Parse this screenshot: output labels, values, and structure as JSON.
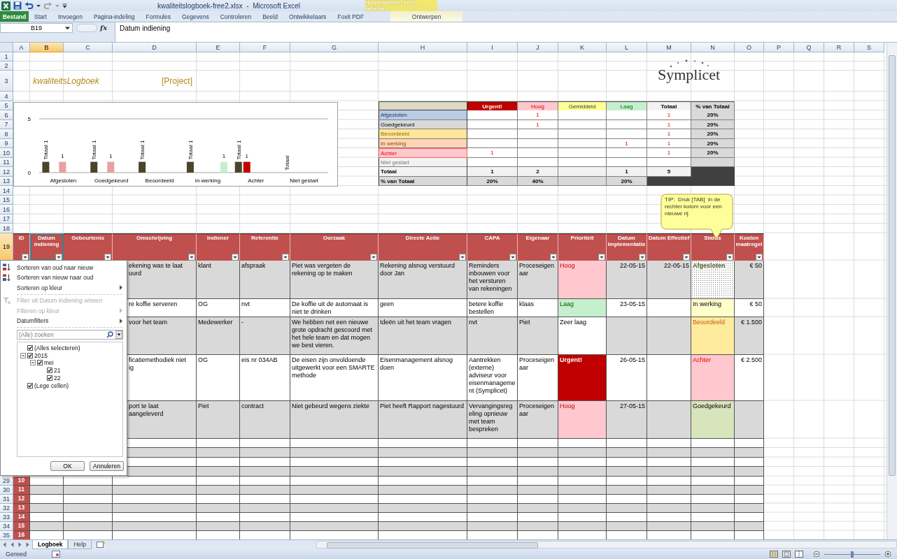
{
  "window": {
    "title": "kwaliteitslogboek-free2.xlsx  -  Microsoft Excel",
    "context_group": "Hulpmiddelen voor tabellen"
  },
  "ribbon_tabs": [
    {
      "label": "Bestand",
      "kind": "file"
    },
    {
      "label": "Start",
      "kind": "normal"
    },
    {
      "label": "Invoegen",
      "kind": "normal"
    },
    {
      "label": "Pagina-indeling",
      "kind": "normal"
    },
    {
      "label": "Formules",
      "kind": "normal"
    },
    {
      "label": "Gegevens",
      "kind": "normal"
    },
    {
      "label": "Controleren",
      "kind": "normal"
    },
    {
      "label": "Beeld",
      "kind": "normal"
    },
    {
      "label": "Ontwikkelaars",
      "kind": "normal"
    },
    {
      "label": "Foxit PDF",
      "kind": "normal"
    },
    {
      "label": "Ontwerpen",
      "kind": "contextual"
    }
  ],
  "formula_bar": {
    "name_box": "B19",
    "function_label": "fx",
    "content": "Datum indiening"
  },
  "sheet": {
    "columns": [
      {
        "letter": "A",
        "selected": false
      },
      {
        "letter": "B",
        "selected": true
      },
      {
        "letter": "C",
        "selected": false
      },
      {
        "letter": "D",
        "selected": false
      },
      {
        "letter": "E",
        "selected": false
      },
      {
        "letter": "F",
        "selected": false
      },
      {
        "letter": "G",
        "selected": false
      },
      {
        "letter": "H",
        "selected": false
      },
      {
        "letter": "I",
        "selected": false
      },
      {
        "letter": "J",
        "selected": false
      },
      {
        "letter": "K",
        "selected": false
      },
      {
        "letter": "L",
        "selected": false
      },
      {
        "letter": "M",
        "selected": false
      },
      {
        "letter": "N",
        "selected": false
      },
      {
        "letter": "O",
        "selected": false
      },
      {
        "letter": "P",
        "selected": false
      },
      {
        "letter": "Q",
        "selected": false
      },
      {
        "letter": "R",
        "selected": false
      },
      {
        "letter": "S",
        "selected": false
      }
    ],
    "row_headers_top": [
      {
        "label": "1",
        "selected": false
      },
      {
        "label": "2",
        "selected": false
      },
      {
        "label": "3",
        "selected": false
      },
      {
        "label": "4",
        "selected": false
      },
      {
        "label": "5",
        "selected": false
      },
      {
        "label": "6",
        "selected": false
      },
      {
        "label": "7",
        "selected": false
      },
      {
        "label": "8",
        "selected": false
      },
      {
        "label": "9",
        "selected": false
      },
      {
        "label": "10",
        "selected": false
      },
      {
        "label": "11",
        "selected": false
      },
      {
        "label": "12",
        "selected": false
      },
      {
        "label": "13",
        "selected": false
      },
      {
        "label": "14",
        "selected": false
      },
      {
        "label": "15",
        "selected": false
      },
      {
        "label": "16",
        "selected": false
      },
      {
        "label": "17",
        "selected": false
      },
      {
        "label": "18",
        "selected": false
      },
      {
        "label": "19",
        "selected": true
      }
    ],
    "row_headers_bottom": [
      {
        "label": "29",
        "selected": false
      },
      {
        "label": "30",
        "selected": false
      },
      {
        "label": "31",
        "selected": false
      },
      {
        "label": "32",
        "selected": false
      },
      {
        "label": "33",
        "selected": false
      },
      {
        "label": "34",
        "selected": false
      },
      {
        "label": "35",
        "selected": false
      }
    ]
  },
  "title": "kwaliteitsLogboek",
  "project": "[Project]",
  "logo": "Symplicet",
  "chart": {
    "chart_data": {
      "type": "bar",
      "categories": [
        "Afgesloten",
        "Goedgekeurd",
        "Beoordeeld",
        "In werking",
        "Achter",
        "Niet gestart"
      ],
      "series": [
        {
          "color": "#4a452a",
          "values": [
            1,
            1,
            1,
            1,
            1,
            null
          ]
        },
        {
          "color": "#c00000",
          "values": [
            null,
            null,
            null,
            null,
            1,
            null
          ]
        },
        {
          "color": "#e6a1a1",
          "values": [
            1,
            1,
            null,
            null,
            null,
            null
          ]
        },
        {
          "color": "#c6efce",
          "values": [
            null,
            null,
            null,
            1,
            null,
            null
          ]
        }
      ],
      "ylim": [
        0,
        5
      ],
      "yticks": [
        0,
        5
      ],
      "value_labels": [
        [
          "Totaal 1",
          "Totaal 1",
          "Totaal 1",
          "Totaal 1",
          "Totaal 1",
          "Totaal"
        ],
        [
          null,
          null,
          null,
          null,
          "1",
          null
        ],
        [
          "1",
          "1",
          null,
          null,
          null,
          null
        ],
        [
          null,
          null,
          null,
          "1",
          null,
          null
        ]
      ]
    }
  },
  "pivot": {
    "columns": [
      {
        "label": "Urgent!",
        "kind": "urgent"
      },
      {
        "label": "Hoog",
        "kind": "high"
      },
      {
        "label": "Gemiddeld",
        "kind": "medium"
      },
      {
        "label": "Laag",
        "kind": "low"
      },
      {
        "label": "Totaal",
        "kind": "total"
      },
      {
        "label": "% van Totaal",
        "kind": "percent"
      }
    ],
    "rows": [
      {
        "label": "Afgesloten",
        "kind": "closed",
        "cells": [
          null,
          "1",
          null,
          null,
          "1",
          "20%"
        ]
      },
      {
        "label": "Goedgekeurd",
        "kind": "approved",
        "cells": [
          null,
          "1",
          null,
          null,
          "1",
          "20%"
        ]
      },
      {
        "label": "Beoordeeld",
        "kind": "reviewed",
        "cells": [
          null,
          null,
          null,
          null,
          "1",
          "20%"
        ]
      },
      {
        "label": "In werking",
        "kind": "in_progress",
        "cells": [
          null,
          null,
          null,
          "1",
          "1",
          "20%"
        ]
      },
      {
        "label": "Achter",
        "kind": "behind",
        "cells": [
          "1",
          null,
          null,
          null,
          "1",
          "20%"
        ]
      },
      {
        "label": "Niet gestart",
        "kind": "not_started",
        "cells": [
          null,
          null,
          null,
          null,
          null,
          null
        ]
      },
      {
        "label": "Totaal",
        "kind": "total",
        "cells": [
          "1",
          "2",
          null,
          "1",
          "5"
        ]
      },
      {
        "label": "% van Totaal",
        "kind": "percent",
        "cells": [
          "20%",
          "40%",
          null,
          "20%"
        ]
      }
    ]
  },
  "comment": {
    "text": "TIP:  Druk [TAB]  in de rechter kolom voor een nieuwe rij"
  },
  "table": {
    "columns": [
      {
        "label": "ID",
        "selected": false
      },
      {
        "label": "Datum indiening",
        "selected": true
      },
      {
        "label": "Gebeurtenis",
        "selected": false
      },
      {
        "label": "Omschrijving",
        "selected": false
      },
      {
        "label": "Indiener",
        "selected": false
      },
      {
        "label": "Referentie",
        "selected": false
      },
      {
        "label": "Oorzaak",
        "selected": false
      },
      {
        "label": "Directe Actie",
        "selected": false
      },
      {
        "label": "CAPA",
        "selected": false
      },
      {
        "label": "Eigenaar",
        "selected": false
      },
      {
        "label": "Prioriteit",
        "selected": false
      },
      {
        "label": "Datum Implementatie",
        "selected": false
      },
      {
        "label": "Datum Effectief",
        "selected": false
      },
      {
        "label": "Status",
        "selected": false
      },
      {
        "label": "Kosten maatregel",
        "selected": false
      }
    ],
    "rows": [
      {
        "omschrijving": "ekening was te laat\nuurd",
        "indiener": "klant",
        "referentie": "afspraak",
        "oorzaak": "Piet was vergeten de rekening op te maken",
        "directe_actie": "Rekening alsnog verstuurd door Jan",
        "capa": "Reminders inbouwen voor het versturen van rekeningen",
        "eigenaar": "Proceseigenaar",
        "prioriteit": {
          "text": "Hoog",
          "kind": "high"
        },
        "datum_implementatie": "22-05-15",
        "datum_effectief": "22-05-15",
        "status": {
          "text": "Afgesloten",
          "kind": "closed"
        },
        "kosten": "€ 50"
      },
      {
        "omschrijving": "re koffie serveren",
        "indiener": "OG",
        "referentie": "nvt",
        "oorzaak": "De koffie uit de automaat is niet te drinken",
        "directe_actie": "geen",
        "capa": "betere koffie bestellen",
        "eigenaar": "klaas",
        "prioriteit": {
          "text": "Laag",
          "kind": "low"
        },
        "datum_implementatie": "23-05-15",
        "datum_effectief": null,
        "status": {
          "text": "In werking",
          "kind": "in_progress"
        },
        "kosten": "€ 50"
      },
      {
        "omschrijving": "voor het team",
        "indiener": "Medewerker",
        "referentie": "-",
        "oorzaak": "We hebben net een nieuwe grote opdracht gescoord met het hele team en dat mogen we best vieren.",
        "directe_actie": "Ideën uit het team vragen",
        "capa": "nvt",
        "eigenaar": "Piet",
        "prioriteit": {
          "text": "Zeer laag",
          "kind": "very_low"
        },
        "datum_implementatie": null,
        "datum_effectief": null,
        "status": {
          "text": "Beoordeeld",
          "kind": "reviewed"
        },
        "kosten": "€ 1.500"
      },
      {
        "omschrijving": "ficatiemethodiek niet\nig",
        "indiener": "OG",
        "referentie": "eis nr 034AB",
        "oorzaak": "De eisen zijn onvoldoende uitgewerkt voor een SMARTE methode",
        "directe_actie": "Eisenmanagement alsnog doen",
        "capa": "Aantrekken (externe) adviseur voor eisenmanagement (Symplicet)",
        "eigenaar": "Proceseigenaar",
        "prioriteit": {
          "text": "Urgent!",
          "kind": "urgent"
        },
        "datum_implementatie": "26-05-15",
        "datum_effectief": null,
        "status": {
          "text": "Achter",
          "kind": "behind"
        },
        "kosten": "€ 2.500"
      },
      {
        "omschrijving": "port te laat aangeleverd",
        "indiener": "Piet",
        "referentie": "contract",
        "oorzaak": "Niet gebeurd wegens ziekte",
        "directe_actie": "Piet heeft Rapport nagestuurd",
        "capa": "Vervangingsregeling opnieuw met team bespreken",
        "eigenaar": "Proceseigenaar",
        "prioriteit": {
          "text": "Hoog",
          "kind": "high"
        },
        "datum_implementatie": "27-05-15",
        "datum_effectief": null,
        "status": {
          "text": "Goedgekeurd",
          "kind": "approved"
        },
        "kosten": null
      }
    ],
    "id_rows": [
      "10",
      "11",
      "12",
      "13",
      "14",
      "15",
      "16"
    ]
  },
  "filter_menu": {
    "item_groups": [
      [
        {
          "label": "Sorteren van oud naar nieuw",
          "kind": "sort-asc",
          "disabled": false,
          "submenu": false
        },
        {
          "label": "Sorteren van nieuw naar oud",
          "kind": "sort-desc",
          "disabled": false,
          "submenu": false
        },
        {
          "label": "Sorteren op kleur",
          "kind": "plain",
          "disabled": false,
          "submenu": true
        }
      ],
      [
        {
          "label": "Filter uit Datum indiening wissen",
          "kind": "clear-filter",
          "disabled": true,
          "submenu": false
        },
        {
          "label": "Filteren op kleur",
          "kind": "plain",
          "disabled": true,
          "submenu": true
        },
        {
          "label": "Datumfilters",
          "kind": "plain",
          "disabled": false,
          "submenu": true
        }
      ]
    ],
    "search": {
      "placeholder": "(Alle) zoeken"
    },
    "tree": [
      {
        "label": "(Alles selecteren)",
        "checked": true
      },
      {
        "label": "2015",
        "checked": true,
        "expanded": true,
        "children": [
          {
            "label": "mei",
            "checked": true,
            "expanded": true,
            "children": [
              {
                "label": "21",
                "checked": true
              },
              {
                "label": "22",
                "checked": true
              }
            ]
          }
        ]
      },
      {
        "label": "(Lege cellen)",
        "checked": true
      }
    ],
    "buttons": [
      "OK",
      "Annuleren"
    ]
  },
  "sheet_tabs": [
    {
      "label": "Logboek",
      "selected": true
    },
    {
      "label": "Help",
      "selected": false
    }
  ],
  "status_bar": {
    "text": "Gereed",
    "zoom": {
      "level": 0.5
    }
  }
}
